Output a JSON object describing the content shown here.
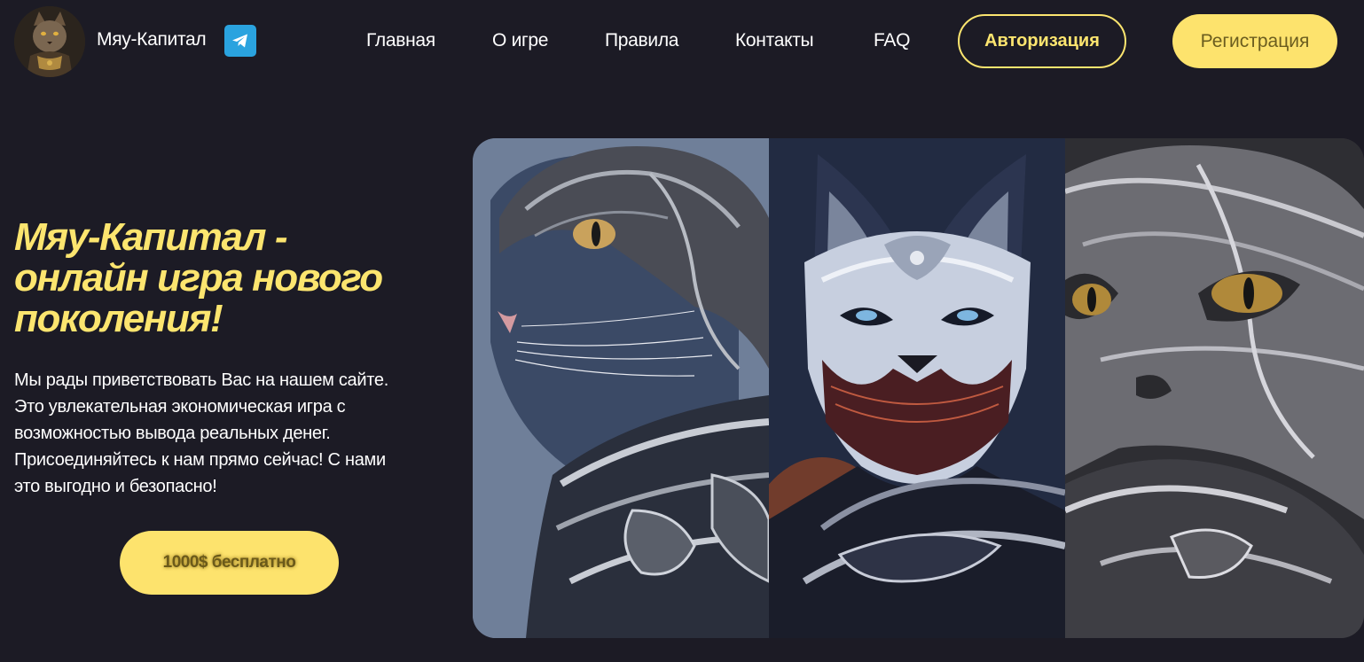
{
  "header": {
    "brand_name": "Мяу-Капитал",
    "logo_icon": "cat-knight-avatar",
    "telegram_icon": "telegram-icon",
    "nav": [
      {
        "label": "Главная"
      },
      {
        "label": "О игре"
      },
      {
        "label": "Правила"
      },
      {
        "label": "Контакты"
      },
      {
        "label": "FAQ"
      }
    ],
    "login_label": "Авторизация",
    "register_label": "Регистрация"
  },
  "hero": {
    "title_lines": [
      "Мяу-Капитал -",
      "онлайн игра нового",
      "поколения!"
    ],
    "text_lines": [
      "Мы рады приветствовать Вас на нашем сайте.",
      "Это увлекательная экономическая игра с",
      "возможностью вывода реальных денег.",
      "Присоединяйтесь к нам прямо сейчас! С нами",
      "это выгодно и безопасно!"
    ],
    "cta_label": "1000$ бесплатно"
  },
  "gallery": {
    "images": [
      {
        "name": "armored-cat-blue"
      },
      {
        "name": "masked-cat-dark"
      },
      {
        "name": "silver-armored-cat"
      }
    ]
  },
  "colors": {
    "background": "#1c1b25",
    "accent": "#fce56f",
    "button_fill": "#fde36d",
    "telegram": "#2aa3df"
  }
}
